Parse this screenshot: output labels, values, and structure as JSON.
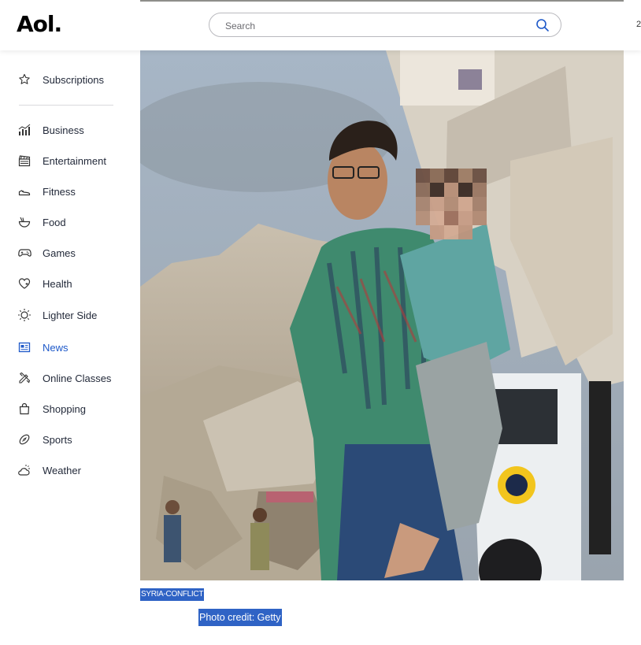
{
  "header": {
    "logo": "Aol.",
    "search_placeholder": "Search",
    "edge_text": "2"
  },
  "sidebar": {
    "items": [
      {
        "label": "Subscriptions",
        "icon": "star-icon"
      },
      {
        "label": "Business",
        "icon": "chart-icon"
      },
      {
        "label": "Entertainment",
        "icon": "clapperboard-icon"
      },
      {
        "label": "Fitness",
        "icon": "sneaker-icon"
      },
      {
        "label": "Food",
        "icon": "bowl-icon"
      },
      {
        "label": "Games",
        "icon": "gamepad-icon"
      },
      {
        "label": "Health",
        "icon": "heart-icon"
      },
      {
        "label": "Lighter Side",
        "icon": "sun-icon"
      },
      {
        "label": "News",
        "icon": "newspaper-icon",
        "active": true
      },
      {
        "label": "Online Classes",
        "icon": "pencil-ruler-icon"
      },
      {
        "label": "Shopping",
        "icon": "shopping-bag-icon"
      },
      {
        "label": "Sports",
        "icon": "football-icon"
      },
      {
        "label": "Weather",
        "icon": "weather-icon"
      }
    ]
  },
  "article": {
    "image_tag": "SYRIA-CONFLICT",
    "photo_credit": "Photo credit: Getty"
  },
  "colors": {
    "accent": "#1e59c9",
    "selection": "#2f63c5"
  }
}
